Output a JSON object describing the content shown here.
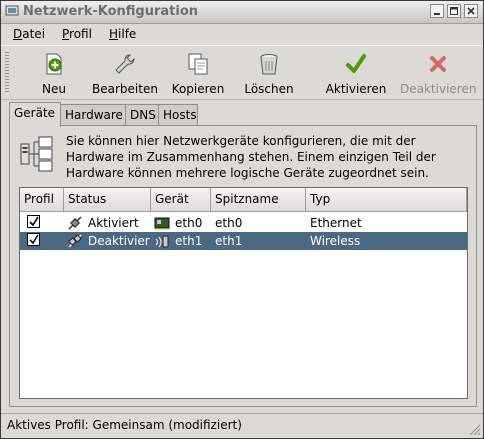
{
  "window": {
    "title": "Netzwerk-Konfiguration"
  },
  "menubar": [
    {
      "label": "Datei",
      "mnemonic": "D",
      "rest": "atei"
    },
    {
      "label": "Profil",
      "mnemonic": "P",
      "rest": "rofil"
    },
    {
      "label": "Hilfe",
      "mnemonic": "H",
      "rest": "ilfe"
    }
  ],
  "toolbar": {
    "new": {
      "label": "Neu"
    },
    "edit": {
      "label": "Bearbeiten"
    },
    "copy": {
      "label": "Kopieren"
    },
    "delete": {
      "label": "Löschen"
    },
    "activate": {
      "label": "Aktivieren"
    },
    "deactivate": {
      "label": "Deaktivieren",
      "enabled": false
    }
  },
  "tabs": [
    {
      "label": "Geräte",
      "active": true
    },
    {
      "label": "Hardware",
      "active": false
    },
    {
      "label": "DNS",
      "active": false
    },
    {
      "label": "Hosts",
      "active": false
    }
  ],
  "devices_panel": {
    "info_lines": [
      "Sie können hier Netzwerkgeräte konfigurieren, die mit der",
      "Hardware im Zusammenhang stehen. Einem einzigen Teil der",
      "Hardware können mehrere logische Geräte zugeordnet sein."
    ],
    "columns": [
      "Profil",
      "Status",
      "Gerät",
      "Spitzname",
      "Typ"
    ],
    "rows": [
      {
        "profile": true,
        "status": "Aktiviert",
        "status_icon": "plug-connected-icon",
        "device": "eth0",
        "device_icon": "ethernet-card-icon",
        "nickname": "eth0",
        "type": "Ethernet",
        "selected": false
      },
      {
        "profile": true,
        "status": "Deaktivier",
        "status_icon": "plug-disconnected-icon",
        "device": "eth1",
        "device_icon": "wireless-icon",
        "nickname": "eth1",
        "type": "Wireless",
        "selected": true
      }
    ]
  },
  "statusbar": {
    "text": "Aktives Profil: Gemeinsam (modifiziert)"
  },
  "colors": {
    "selection": "#4b6983",
    "window_bg": "#dcdad5",
    "accent_green": "#4e9a06",
    "accent_red": "#cc3333"
  }
}
